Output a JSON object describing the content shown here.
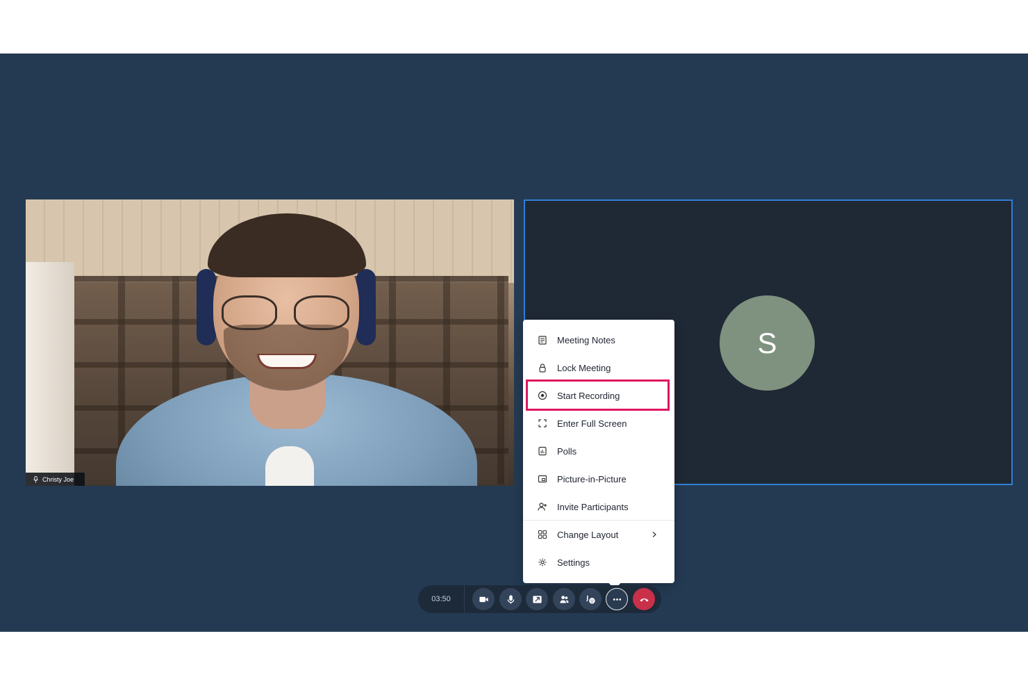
{
  "participants": {
    "local": {
      "name": "Christy Joe",
      "mic_icon": "mic-icon"
    },
    "remote": {
      "initial": "S",
      "avatar_color": "#7f927f"
    }
  },
  "menu": {
    "items": [
      {
        "label": "Meeting Notes",
        "icon": "notes-icon"
      },
      {
        "label": "Lock Meeting",
        "icon": "lock-icon"
      },
      {
        "label": "Start Recording",
        "icon": "record-icon",
        "highlighted": true
      },
      {
        "label": "Enter Full Screen",
        "icon": "fullscreen-icon"
      },
      {
        "label": "Polls",
        "icon": "poll-icon"
      },
      {
        "label": "Picture-in-Picture",
        "icon": "pip-icon"
      },
      {
        "label": "Invite Participants",
        "icon": "invite-icon"
      },
      {
        "label": "Change Layout",
        "icon": "layout-icon",
        "submenu": true
      },
      {
        "label": "Settings",
        "icon": "gear-icon"
      }
    ]
  },
  "controls": {
    "timer": "03:50",
    "buttons": [
      "camera-icon",
      "mic-icon",
      "share-screen-icon",
      "participants-icon",
      "reactions-icon",
      "more-icon",
      "end-call-icon"
    ]
  },
  "colors": {
    "stage_bg": "#243a52",
    "highlight": "#e0175f",
    "active_border": "#2f7fd6",
    "end_call": "#c9304a"
  }
}
